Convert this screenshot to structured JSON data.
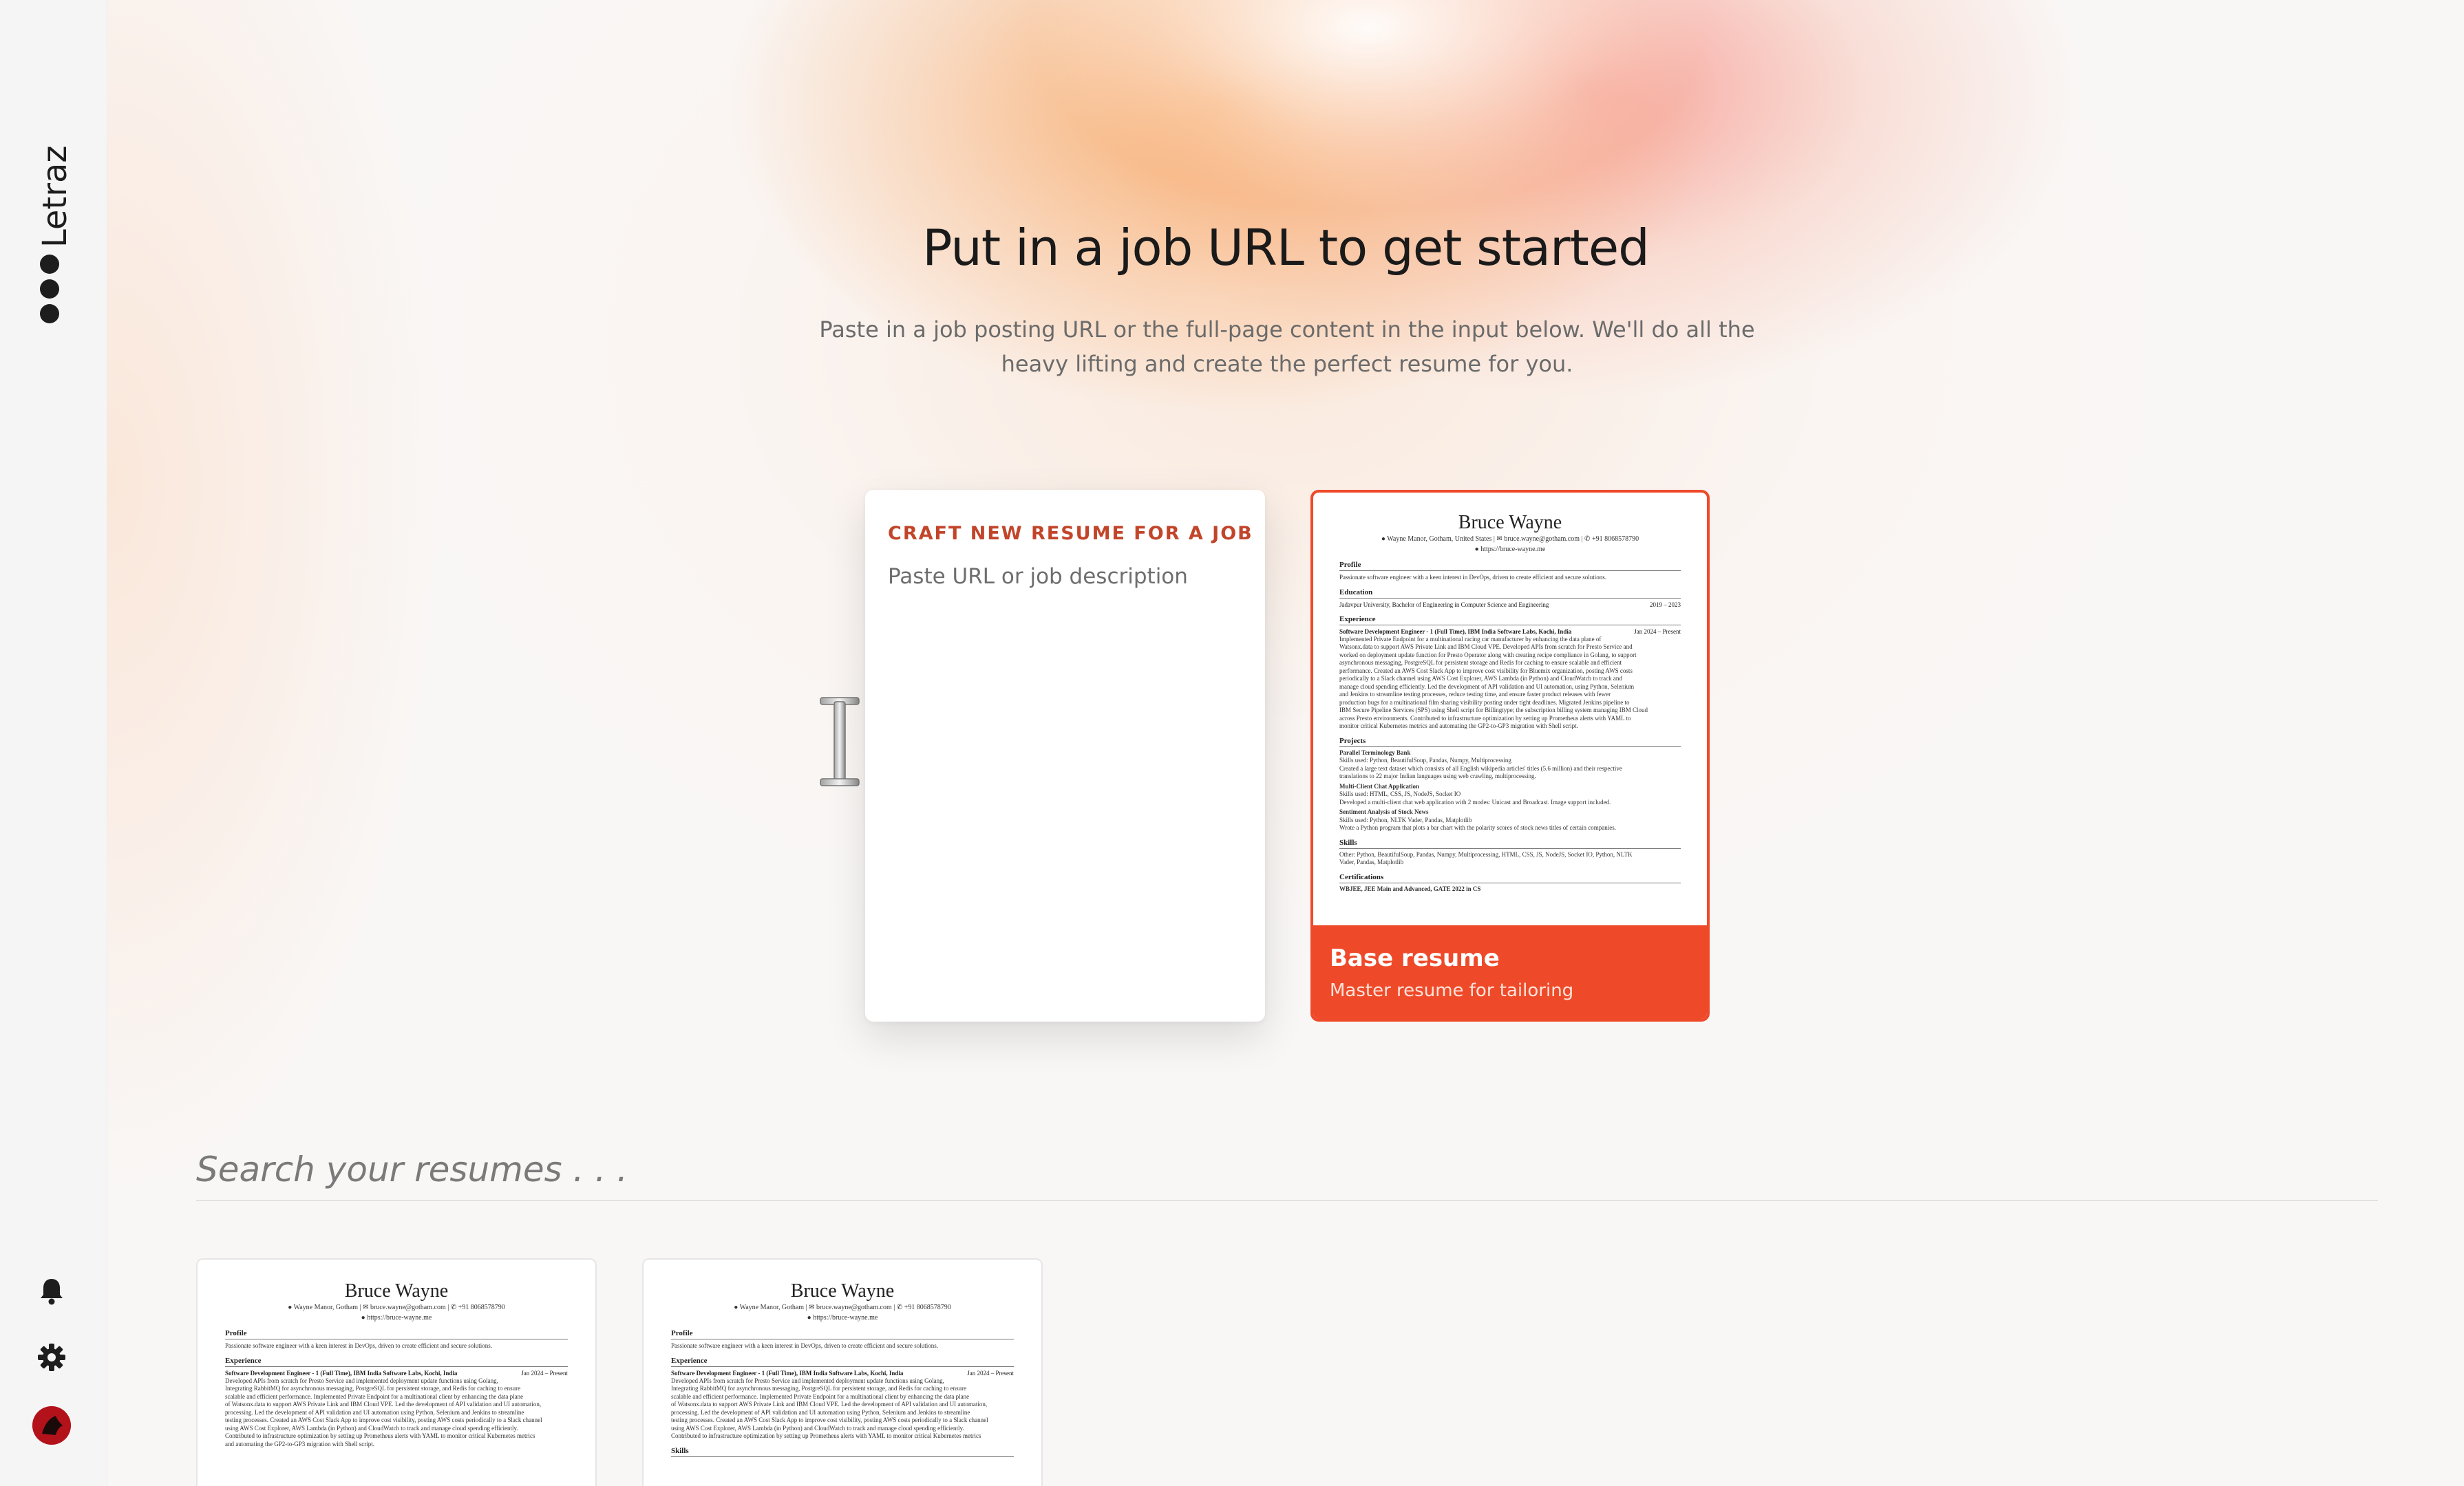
{
  "sidebar": {
    "brand": "Letraz",
    "icons": [
      "bell-icon",
      "gear-icon",
      "avatar"
    ]
  },
  "hero": {
    "title": "Put in a job URL to get started",
    "subtitle_line1": "Paste in a job posting URL or the full-page content in the input below. We'll do all the",
    "subtitle_line2": "heavy lifting and create the perfect resume for you."
  },
  "craft": {
    "label": "CRAFT NEW RESUME FOR A JOB",
    "placeholder": "Paste URL or job description"
  },
  "base_resume": {
    "title": "Base resume",
    "subtitle": "Master resume for tailoring"
  },
  "search": {
    "placeholder": "Search your resumes . . ."
  },
  "resume": {
    "name": "Bruce Wayne",
    "address": "Wayne Manor, Gotham, United States",
    "address_short": "Wayne Manor, Gotham",
    "email": "bruce.wayne@gotham.com",
    "phone": "+91 8068578790",
    "website": "https://bruce-wayne.me",
    "profile_heading": "Profile",
    "profile": "Passionate software engineer with a keen interest in DevOps, driven to create efficient and secure solutions.",
    "education_heading": "Education",
    "education": "Jadavpur University, Bachelor of Engineering in Computer Science and Engineering",
    "education_dates": "2019 – 2023",
    "experience_heading": "Experience",
    "job": "Software Development Engineer - 1 (Full Time), IBM India Software Labs, Kochi, India",
    "job_dates": "Jan 2024 – Present",
    "job_desc_1": "Implemented Private Endpoint for a multinational racing car manufacturer by enhancing the data plane of",
    "job_desc_2": "Watsonx.data to support AWS Private Link and IBM Cloud VPE. Developed APIs from scratch for Presto Service and",
    "job_desc_3": "worked on deployment update function for Presto Operator along with creating recipe compliance in Golang, to support",
    "job_desc_4": "asynchronous messaging, PostgreSQL for persistent storage and Redis for caching to ensure scalable and efficient",
    "job_desc_5": "performance. Created an AWS Cost Slack App to improve cost visibility for Bluemix organization, posting AWS costs",
    "job_desc_6": "periodically to a Slack channel using AWS Cost Explorer, AWS Lambda (in Python) and CloudWatch to track and",
    "job_desc_7": "manage cloud spending efficiently. Led the development of API validation and UI automation, using Python, Selenium",
    "job_desc_8": "and Jenkins to streamline testing processes, reduce testing time, and ensure faster product releases with fewer",
    "job_desc_9": "production bugs for a multinational film sharing visibility posting under tight deadlines. Migrated Jenkins pipeline to",
    "job_desc_10": "IBM Secure Pipeline Services (SPS) using Shell script for Billingtype; the subscription billing system managing IBM Cloud",
    "job_desc_11": "across Presto environments. Contributed to infrastructure optimization by setting up Prometheus alerts with YAML to",
    "job_desc_12": "monitor critical Kubernetes metrics and automating the GP2-to-GP3 migration with Shell script.",
    "projects_heading": "Projects",
    "p1_title": "Parallel Terminology Bank",
    "p1_skills": "Skills used: Python, BeautifulSoup, Pandas, Numpy, Multiprocessing",
    "p1_desc_1": "Created a large text dataset which consists of all English wikipedia articles' titles (5.6 million) and their respective",
    "p1_desc_2": "translations to 22 major Indian languages using web crawling, multiprocessing.",
    "p2_title": "Multi-Client Chat Application",
    "p2_skills": "Skills used: HTML, CSS, JS, NodeJS, Socket IO",
    "p2_desc": "Developed a multi-client chat web application with 2 modes: Unicast and Broadcast. Image support included.",
    "p3_title": "Sentiment Analysis of Stock News",
    "p3_skills": "Skills used: Python, NLTK Vader, Pandas, Matplotlib",
    "p3_desc": "Wrote a Python program that plots a bar chart with the polarity scores of stock news titles of certain companies.",
    "skills_heading": "Skills",
    "skills_1": "Other: Python, BeautifulSoup, Pandas, Numpy, Multiprocessing, HTML, CSS, JS, NodeJS, Socket IO, Python, NLTK",
    "skills_2": "Vader, Pandas, Matplotlib",
    "cert_heading": "Certifications",
    "cert": "WBJEE, JEE Main and Advanced, GATE 2022 in CS",
    "t_job_desc_1": "Developed APIs from scratch for Presto Service and implemented deployment update functions using Golang,",
    "t_job_desc_2": "Integrating RabbitMQ for asynchronous messaging, PostgreSQL for persistent storage, and Redis for caching to ensure",
    "t_job_desc_3": "scalable and efficient performance. Implemented Private Endpoint for a multinational client by enhancing the data plane",
    "t_job_desc_4": "of Watsonx.data to support AWS Private Link and IBM Cloud VPE. Led the development of API validation and UI automation,",
    "t_job_desc_5": "processing. Led the development of API validation and UI automation using Python, Selenium and Jenkins to streamline",
    "t_job_desc_6": "testing processes. Created an AWS Cost Slack App to improve cost visibility, posting AWS costs periodically to a Slack channel",
    "t_job_desc_7": "using AWS Cost Explorer, AWS Lambda (in Python) and CloudWatch to track and manage cloud spending efficiently.",
    "t_job_desc_8": "Contributed to infrastructure optimization by setting up Prometheus alerts with YAML to monitor critical Kubernetes metrics",
    "t_job_desc_9": "and automating the GP2-to-GP3 migration with Shell script."
  },
  "colors": {
    "accent": "#ee4a2a",
    "label": "#c2452a",
    "brand_dark": "#1d1d1d"
  }
}
